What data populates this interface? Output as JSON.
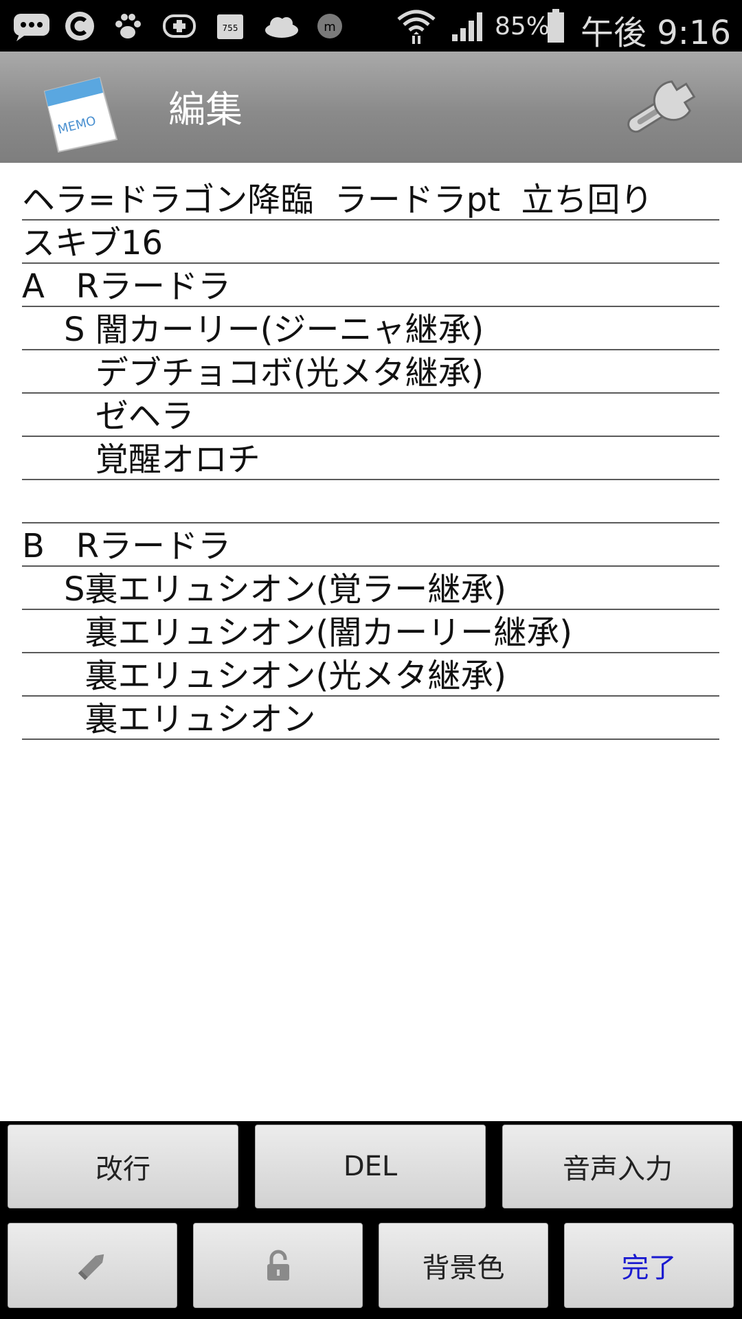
{
  "status_bar": {
    "battery_percent": "85%",
    "time": "午後 9:16",
    "icons": [
      "chat-icon",
      "c-icon",
      "paw-icon",
      "game-icon",
      "app-icon",
      "cloud-icon",
      "messenger-icon",
      "wifi-icon",
      "signal-icon",
      "battery-icon"
    ]
  },
  "action_bar": {
    "title": "編集",
    "app_icon_label": "MEMO",
    "settings_icon": "wrench-icon"
  },
  "memo": {
    "lines": [
      "ヘラ=ドラゴン降臨  ラードラpt  立ち回り",
      "スキブ16",
      "A   Rラードラ",
      "    S 闇カーリー(ジーニャ継承)",
      "       デブチョコボ(光メタ継承)",
      "       ゼヘラ",
      "       覚醒オロチ",
      "",
      "B   Rラードラ",
      "    S裏エリュシオン(覚ラー継承)",
      "      裏エリュシオン(闇カーリー継承)",
      "      裏エリュシオン(光メタ継承)",
      "      裏エリュシオン"
    ]
  },
  "buttons": {
    "newline": "改行",
    "delete": "DEL",
    "voice_input": "音声入力",
    "background_color": "背景色",
    "done": "完了",
    "pencil_icon": "pencil-icon",
    "lock_icon": "lock-icon"
  },
  "colors": {
    "action_bar": "#8f8f8f",
    "done_text": "#1a1ad0",
    "panel_bg": "#000000"
  }
}
